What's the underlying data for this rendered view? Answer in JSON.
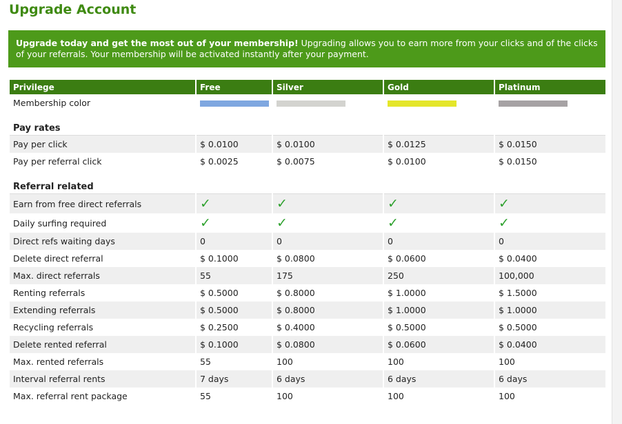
{
  "page": {
    "title": "Upgrade Account"
  },
  "banner": {
    "bold_text": "Upgrade today and get the most out of your membership!",
    "text": " Upgrading allows you to earn more from your clicks and of the clicks of your referrals. Your membership will be activated instantly after your payment."
  },
  "table": {
    "headers": [
      "Privilege",
      "Free",
      "Silver",
      "Gold",
      "Platinum"
    ],
    "membership_color": {
      "label": "Membership color",
      "colors": [
        "#7fa7e0",
        "#d3d3cf",
        "#e4e62a",
        "#a6a2a4"
      ]
    },
    "sections": [
      {
        "title": "Pay rates",
        "rows": [
          {
            "label": "Pay per click",
            "values": [
              "$ 0.0100",
              "$ 0.0100",
              "$ 0.0125",
              "$ 0.0150"
            ]
          },
          {
            "label": "Pay per referral click",
            "values": [
              "$ 0.0025",
              "$ 0.0075",
              "$ 0.0100",
              "$ 0.0150"
            ]
          }
        ]
      },
      {
        "title": "Referral related",
        "rows": [
          {
            "label": "Earn from free direct referrals",
            "values": [
              "✓",
              "✓",
              "✓",
              "✓"
            ]
          },
          {
            "label": "Daily surfing required",
            "values": [
              "✓",
              "✓",
              "✓",
              "✓"
            ]
          },
          {
            "label": "Direct refs waiting days",
            "values": [
              "0",
              "0",
              "0",
              "0"
            ]
          },
          {
            "label": "Delete direct referral",
            "values": [
              "$ 0.1000",
              "$ 0.0800",
              "$ 0.0600",
              "$ 0.0400"
            ]
          },
          {
            "label": "Max. direct referrals",
            "values": [
              "55",
              "175",
              "250",
              "100,000"
            ]
          },
          {
            "label": "Renting referrals",
            "values": [
              "$ 0.5000",
              "$ 0.8000",
              "$ 1.0000",
              "$ 1.5000"
            ]
          },
          {
            "label": "Extending referrals",
            "values": [
              "$ 0.5000",
              "$ 0.8000",
              "$ 1.0000",
              "$ 1.0000"
            ]
          },
          {
            "label": "Recycling referrals",
            "values": [
              "$ 0.2500",
              "$ 0.4000",
              "$ 0.5000",
              "$ 0.5000"
            ]
          },
          {
            "label": "Delete rented referral",
            "values": [
              "$ 0.1000",
              "$ 0.0800",
              "$ 0.0600",
              "$ 0.0400"
            ]
          },
          {
            "label": "Max. rented referrals",
            "values": [
              "55",
              "100",
              "100",
              "100"
            ]
          },
          {
            "label": "Interval referral rents",
            "values": [
              "7 days",
              "6 days",
              "6 days",
              "6 days"
            ]
          },
          {
            "label": "Max. referral rent package",
            "values": [
              "55",
              "100",
              "100",
              "100"
            ]
          }
        ]
      }
    ]
  },
  "icons": {
    "check": "check-icon"
  }
}
